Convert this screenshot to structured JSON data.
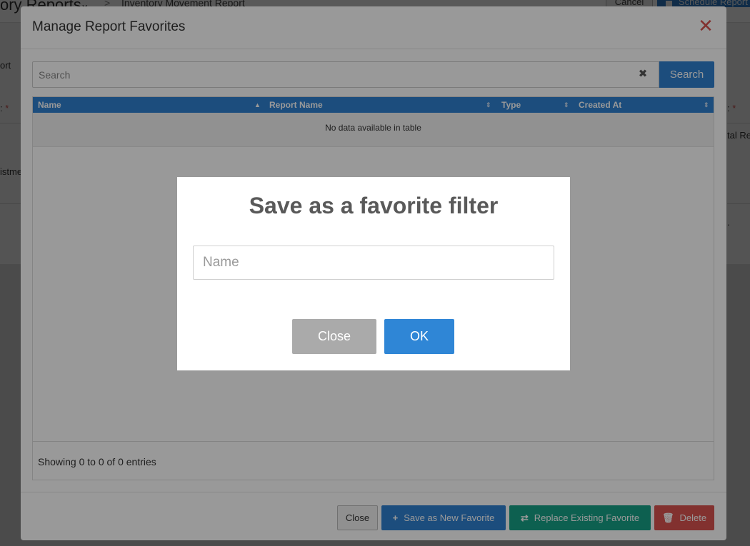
{
  "background": {
    "title": "ory Reports",
    "breadcrumb_sep": ">",
    "breadcrumb": "Inventory Movement Report",
    "cancel_label": "Cancel",
    "schedule_label": "Schedule Report",
    "left_fragments": [
      "ort",
      ":",
      "istme"
    ],
    "right_fragments": [
      ":",
      "tal Re",
      "."
    ]
  },
  "manage_modal": {
    "title": "Manage Report Favorites",
    "close_glyph": "✕",
    "search": {
      "placeholder": "Search",
      "clear_glyph": "✖",
      "button_label": "Search"
    },
    "table": {
      "columns": [
        "Name",
        "Report Name",
        "Type",
        "Created At"
      ],
      "empty_message": "No data available in table",
      "info": "Showing 0 to 0 of 0 entries"
    },
    "footer": {
      "close_label": "Close",
      "save_new_label": "Save as New Favorite",
      "replace_label": "Replace Existing Favorite",
      "delete_label": "Delete"
    }
  },
  "favorite_dialog": {
    "title": "Save as a favorite filter",
    "name_placeholder": "Name",
    "close_label": "Close",
    "ok_label": "OK"
  },
  "colors": {
    "primary": "#2f80d1",
    "teal": "#16a085",
    "danger": "#d9534f",
    "gray_button": "#aaaaaa"
  },
  "icons": {
    "save_new": "plus-icon",
    "replace": "swap-icon",
    "delete": "trash-icon",
    "close": "close-icon",
    "clear": "clear-icon",
    "sort": "sort-icon"
  }
}
